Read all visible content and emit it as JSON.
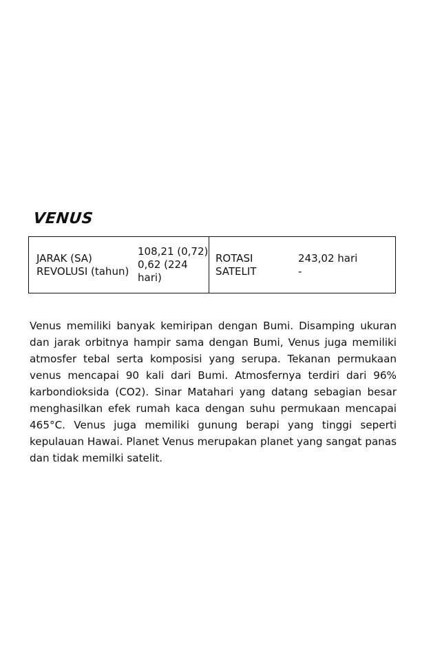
{
  "planet": {
    "name": "VENUS"
  },
  "stats": {
    "left": {
      "labels": [
        "JARAK (SA)",
        "REVOLUSI (tahun)"
      ],
      "values": [
        "108,21 (0,72)",
        "0,62 (224 hari)"
      ]
    },
    "right": {
      "labels": [
        "ROTASI",
        "SATELIT"
      ],
      "values": [
        "243,02 hari",
        "-"
      ]
    }
  },
  "description": "Venus memiliki banyak kemiripan dengan Bumi. Disamping ukuran dan jarak orbitnya hampir sama dengan Bumi, Venus juga memiliki atmosfer tebal serta komposisi yang serupa. Tekanan permukaan venus mencapai 90 kali dari Bumi. Atmosfernya terdiri dari 96% karbondioksida (CO2). Sinar Matahari yang datang sebagian besar menghasilkan efek rumah kaca dengan suhu permukaan mencapai 465°C. Venus juga memiliki gunung berapi yang tinggi seperti kepulauan Hawai. Planet Venus merupakan planet yang sangat panas dan tidak memilki satelit."
}
